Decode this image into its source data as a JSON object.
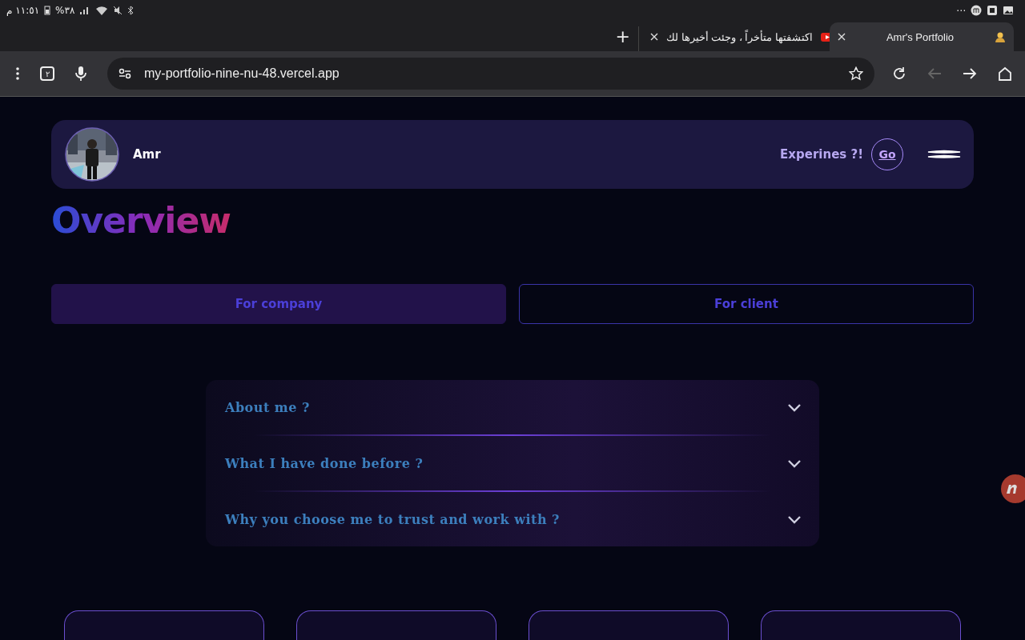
{
  "status_bar": {
    "time": "١١:٥١ م",
    "battery": "٣٨%",
    "more": "⋯"
  },
  "browser_tabs": [
    {
      "title": "اكتشفتها متأخراً ، وجئت أخيرها لك",
      "selected": false
    },
    {
      "title": "Amr's Portfolio",
      "selected": true
    }
  ],
  "new_tab": "+",
  "toolbar": {
    "tab_count": "٢",
    "url": "my-portfolio-nine-nu-48.vercel.app",
    "back_disabled": true
  },
  "header": {
    "name": "Amr",
    "prompt": "Experines ?!",
    "go": "Go"
  },
  "title": "Overview",
  "audience_tabs": [
    {
      "label": "For company",
      "selected": true
    },
    {
      "label": "For client",
      "selected": false
    }
  ],
  "faq": [
    {
      "question": "About me ?",
      "expanded": false
    },
    {
      "question": "What I have done before ?",
      "expanded": false
    },
    {
      "question": "Why you choose me to trust and work with ?",
      "expanded": false
    }
  ],
  "cards": [
    {
      "kind": "card"
    },
    {
      "kind": "card"
    },
    {
      "kind": "card"
    },
    {
      "kind": "card"
    }
  ]
}
